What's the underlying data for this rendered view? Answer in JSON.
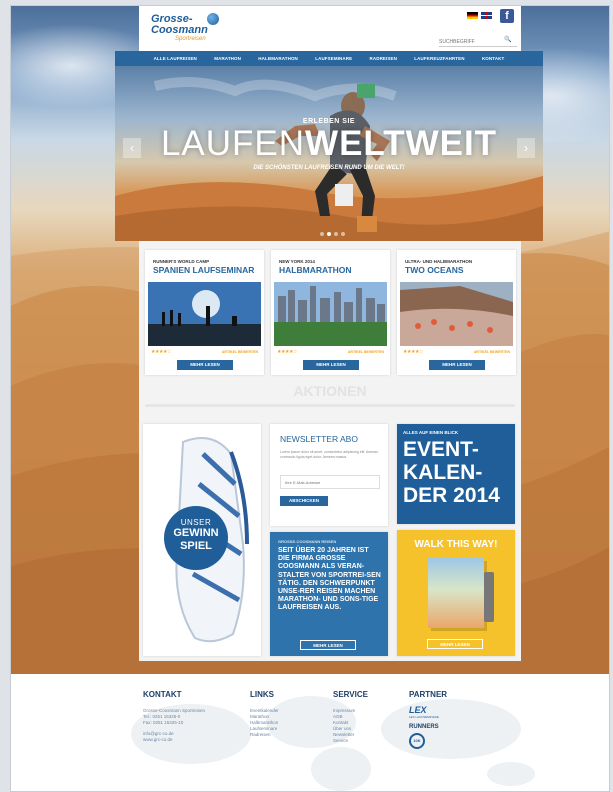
{
  "logo": {
    "line1": "Grosse-",
    "line2": "Coosmann",
    "line3": "Sportreisen"
  },
  "search": {
    "placeholder": "SUCHBEGRIFF"
  },
  "facebook": "f",
  "nav": [
    "ALLE LAUFREISEN",
    "MARATHON",
    "HALBMARATHON",
    "LAUFSEMINARE",
    "RADREISEN",
    "LAUFKREUZFAHRTEN",
    "KONTAKT"
  ],
  "hero": {
    "kicker": "ERLEBEN SIE",
    "title_thin": "LAUFEN",
    "title_bold": "WELTWEIT",
    "subtitle": "DIE SCHÖNSTEN LAUFREISEN RUND UM DIE WELT!",
    "prev": "‹",
    "next": "›"
  },
  "cards": [
    {
      "kicker": "RUNNER'S WORLD CAMP",
      "title": "SPANIEN LAUFSEMINAR",
      "rating_label": "ARTIKEL BEWERTEN",
      "button": "MEHR LESEN",
      "stars": "★★★★☆"
    },
    {
      "kicker": "NEW YORK 2014",
      "title": "HALBMARATHON",
      "rating_label": "ARTIKEL BEWERTEN",
      "button": "MEHR LESEN",
      "stars": "★★★★☆"
    },
    {
      "kicker": "ULTRA- UND HALBMARATHON",
      "title": "TWO OCEANS",
      "rating_label": "ARTIKEL BEWERTEN",
      "button": "MEHR LESEN",
      "stars": "★★★★☆"
    }
  ],
  "aktionen": "AKTIONEN",
  "gewinnspiel": {
    "line1": "UNSER",
    "line2": "GEWINN",
    "line3": "SPIEL"
  },
  "newsletter": {
    "title": "NEWSLETTER ABO",
    "text": "Lorem ipsum dolor sit amet, consectetur adipiscing elit. Aenean commodo ligula eget dolor. Aenean massa.",
    "placeholder": "Ihre E-Mail-Adresse",
    "button": "ABSCHICKEN"
  },
  "event": {
    "kicker": "ALLES AUF EINEN BLICK",
    "line1": "EVENT-",
    "line2": "KALEN-",
    "line3": "DER 2014"
  },
  "about": {
    "kicker": "GROSSE-COOSMANN REISEN",
    "text": "SEIT ÜBER 20 JAHREN IST DIE FIRMA GROSSE COOSMANN ALS VERAN-STALTER VON SPORTREI-SEN TÄTIG. DEN SCHWERPUNKT UNSE-RER REISEN MACHEN MARATHON- UND SONS-TIGE LAUFREISEN AUS.",
    "button": "MEHR LESEN"
  },
  "walk": {
    "title": "WALK THIS WAY!",
    "button": "MEHR LESEN"
  },
  "footer": {
    "kontakt": {
      "title": "KONTAKT",
      "l1": "Grosse-Coosmann Sportreisen",
      "l2": "Tel.: 0251 15325-0",
      "l3": "Fax: 0251 15325-10",
      "l4": "info@grc-co.de",
      "l5": "www.grc-co.de"
    },
    "links": {
      "title": "LINKS",
      "items": [
        "Eventkalender",
        "Marathon",
        "Halbmarathon",
        "Laufseminare",
        "Radreisen"
      ]
    },
    "service": {
      "title": "SERVICE",
      "items": [
        "Impressum",
        "AGB",
        "Kontakt",
        "Über uns",
        "Newsletter",
        "Service"
      ]
    },
    "partner": {
      "title": "PARTNER",
      "lex": "LEX",
      "lex_sub": "LEX LAUFSEMINARE",
      "runners": "RUNNERS",
      "badge": "10K"
    }
  }
}
